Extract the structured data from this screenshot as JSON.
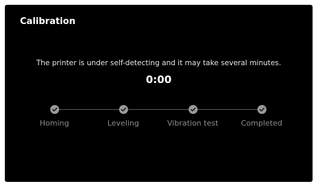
{
  "header": {
    "title": "Calibration"
  },
  "main": {
    "message": "The printer is under self-detecting and it may take several minutes.",
    "timer": "0:00"
  },
  "steps": [
    {
      "label": "Homing",
      "icon": "check-icon",
      "status": "done"
    },
    {
      "label": "Leveling",
      "icon": "check-icon",
      "status": "done"
    },
    {
      "label": "Vibration test",
      "icon": "check-icon",
      "status": "done"
    },
    {
      "label": "Completed",
      "icon": "check-icon",
      "status": "done"
    }
  ],
  "colors": {
    "background": "#000000",
    "step_dot": "#9a9a9a",
    "step_label": "#8c8c8c",
    "connector": "#5a5a5a"
  }
}
